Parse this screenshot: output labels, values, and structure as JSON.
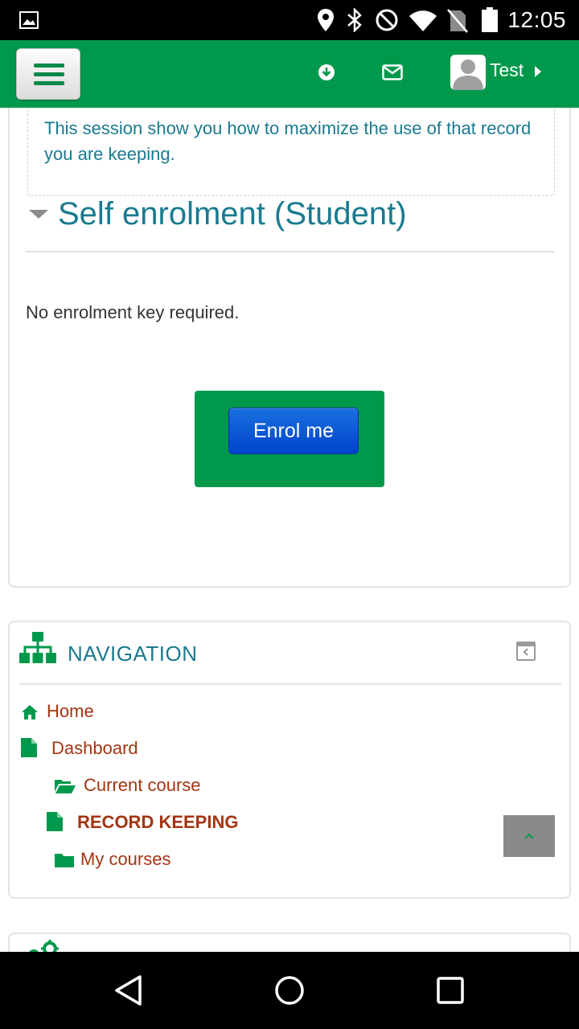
{
  "status_bar": {
    "time": "12:05",
    "icons": [
      "image-icon",
      "location-icon",
      "bluetooth-icon",
      "do-not-disturb-icon",
      "wifi-icon",
      "no-sim-icon",
      "battery-icon"
    ]
  },
  "header": {
    "menu_icon": "hamburger-menu-icon",
    "icons": [
      "download-icon",
      "mail-icon"
    ],
    "user_name": "Test",
    "brand_color": "#00994c"
  },
  "course": {
    "summary": "This session show you how to maximize the use of that record you are keeping.",
    "section_title": "Self enrolment (Student)",
    "enrol_note": "No enrolment key required.",
    "enrol_button": "Enrol me"
  },
  "navigation": {
    "title": "NAVIGATION",
    "items": [
      {
        "label": "Home",
        "icon": "home-icon"
      },
      {
        "label": "Dashboard",
        "icon": "file-icon"
      },
      {
        "label": "Current course",
        "icon": "folder-open-icon"
      },
      {
        "label": "RECORD KEEPING",
        "icon": "file-icon"
      },
      {
        "label": "My courses",
        "icon": "folder-icon"
      }
    ]
  },
  "colors": {
    "accent_green": "#00994c",
    "link_red": "#a33512",
    "heading_teal": "#1a7a90",
    "button_blue": "#0044cc"
  }
}
